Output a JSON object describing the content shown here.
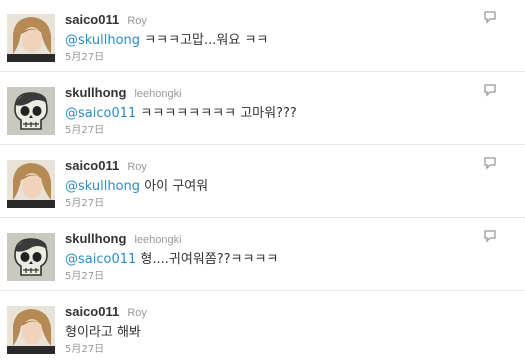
{
  "tweets": [
    {
      "screen_name": "saico011",
      "real_name": "Roy",
      "mention": "@skullhong",
      "text": " ㅋㅋㅋ고맙...워요 ㅋㅋ",
      "time": "5月27日",
      "avatar": "portrait-avatar"
    },
    {
      "screen_name": "skullhong",
      "real_name": "leehongki",
      "mention": "@saico011",
      "text": " ㅋㅋㅋㅋㅋㅋㅋㅋ 고마워???",
      "time": "5月27日",
      "avatar": "skull-avatar"
    },
    {
      "screen_name": "saico011",
      "real_name": "Roy",
      "mention": "@skullhong",
      "text": " 아이 구여워",
      "time": "5月27日",
      "avatar": "portrait-avatar"
    },
    {
      "screen_name": "skullhong",
      "real_name": "leehongki",
      "mention": "@saico011",
      "text": " 형....귀여워쫌??ㅋㅋㅋㅋ",
      "time": "5月27日",
      "avatar": "skull-avatar"
    },
    {
      "screen_name": "saico011",
      "real_name": "Roy",
      "mention": "",
      "text": "형이라고 해봐",
      "time": "5月27日",
      "avatar": "portrait-avatar"
    }
  ],
  "colors": {
    "mention": "#2b8cc4",
    "meta": "#999999",
    "text": "#333333",
    "divider": "#e8e8e8"
  },
  "icons": {
    "reply": "reply-bubble-icon"
  }
}
